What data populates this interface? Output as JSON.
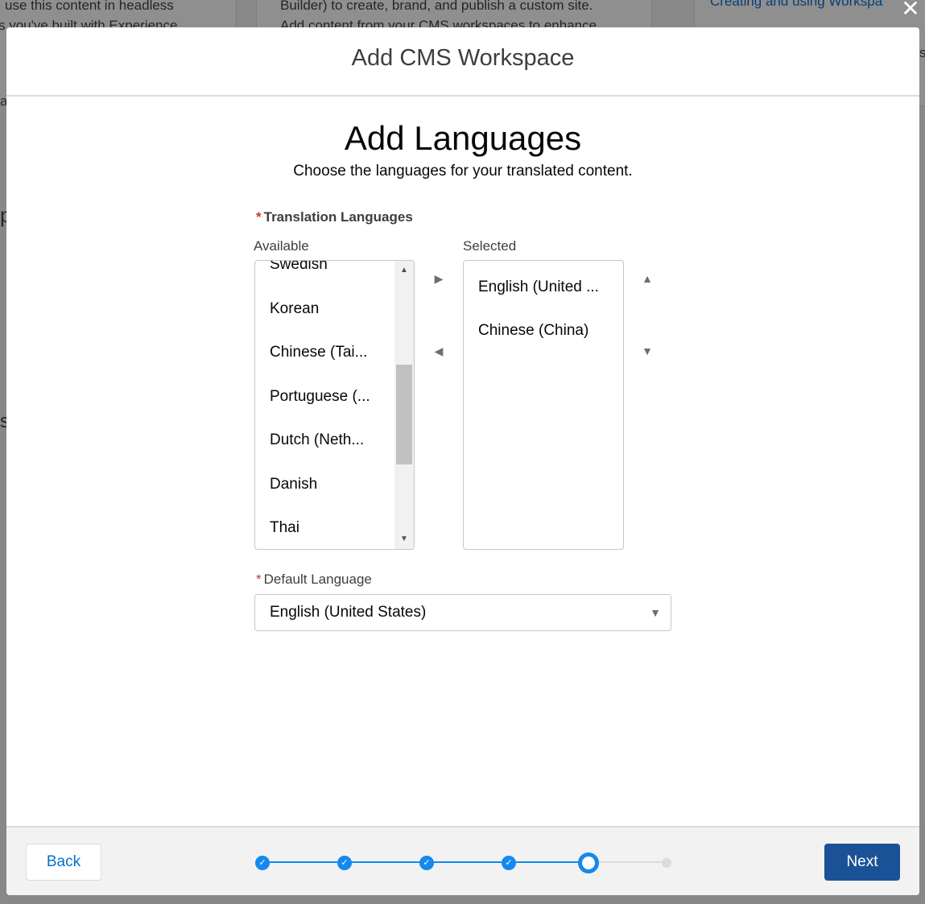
{
  "background": {
    "card1_line1": "use this content in headless",
    "card1_line2": "s you've built with Experience",
    "card2_line1": "Builder) to create, brand, and publish a custom site.",
    "card2_line2": "Add content from your CMS workspaces to enhance",
    "card3_link": "Creating and using Workspa",
    "side_chars": [
      "a",
      "p",
      "s"
    ],
    "right_char": "s"
  },
  "modal": {
    "title": "Add CMS Workspace",
    "close_icon": "close-icon",
    "step_title": "Add Languages",
    "step_subtitle": "Choose the languages for your translated content.",
    "translation": {
      "required_mark": "*",
      "label": "Translation Languages",
      "available_label": "Available",
      "selected_label": "Selected",
      "available": [
        "Swedish",
        "Korean",
        "Chinese (Tai...",
        "Portuguese (...",
        "Dutch (Neth...",
        "Danish",
        "Thai"
      ],
      "selected": [
        "English (United ...",
        "Chinese (China)"
      ]
    },
    "default_language": {
      "required_mark": "*",
      "label": "Default Language",
      "value": "English (United States)"
    },
    "footer": {
      "back_label": "Back",
      "next_label": "Next",
      "progress": {
        "total_steps": 6,
        "current_step": 5
      }
    }
  },
  "colors": {
    "brand": "#1b5297",
    "progress": "#1589ee",
    "required": "#c23934"
  }
}
